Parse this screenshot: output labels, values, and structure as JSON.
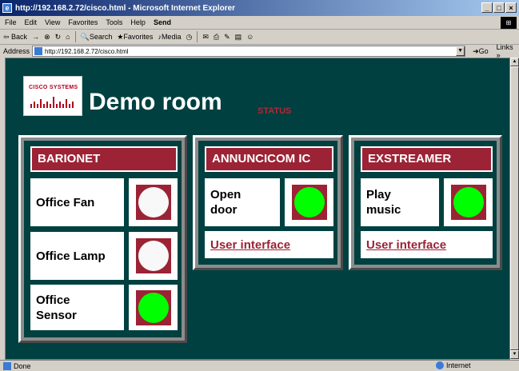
{
  "window": {
    "title": "http://192.168.2.72/cisco.html - Microsoft Internet Explorer",
    "controls": [
      "_",
      "□",
      "×"
    ]
  },
  "menu": {
    "items": [
      "File",
      "Edit",
      "View",
      "Favorites",
      "Tools",
      "Help"
    ],
    "send": "Send"
  },
  "toolbar": {
    "back": "Back",
    "forward": "→",
    "stop": "⊗",
    "refresh": "↻",
    "home": "⌂",
    "search": "Search",
    "favorites": "Favorites",
    "media": "Media",
    "history": "◷",
    "mail": "✉",
    "print": "⎙",
    "edit": "✎",
    "discuss": "▤",
    "messenger": "☺"
  },
  "address": {
    "label": "Address",
    "url": "http://192.168.2.72/cisco.html",
    "go": "Go",
    "links": "Links »"
  },
  "status": {
    "text": "Done",
    "zone": "Internet"
  },
  "page": {
    "logo_text": "CISCO SYSTEMS",
    "title": "Demo room",
    "status_link": "STATUS",
    "barionet": {
      "header": "BARIONET",
      "rows": [
        {
          "label": "Office Fan",
          "state": "off"
        },
        {
          "label": "Office Lamp",
          "state": "off"
        },
        {
          "label": "Office Sensor",
          "state": "on"
        }
      ]
    },
    "annuncicom": {
      "header": "ANNUNCICOM IC",
      "rows": [
        {
          "label": "Open door",
          "state": "on"
        }
      ],
      "link": "User interface"
    },
    "exstreamer": {
      "header": "EXSTREAMER",
      "rows": [
        {
          "label": "Play music",
          "state": "on"
        }
      ],
      "link": "User interface"
    }
  },
  "colors": {
    "background": "#004040",
    "accent": "#9b2335",
    "led_on": "#00ff00",
    "led_off": "#f8f8f8"
  }
}
